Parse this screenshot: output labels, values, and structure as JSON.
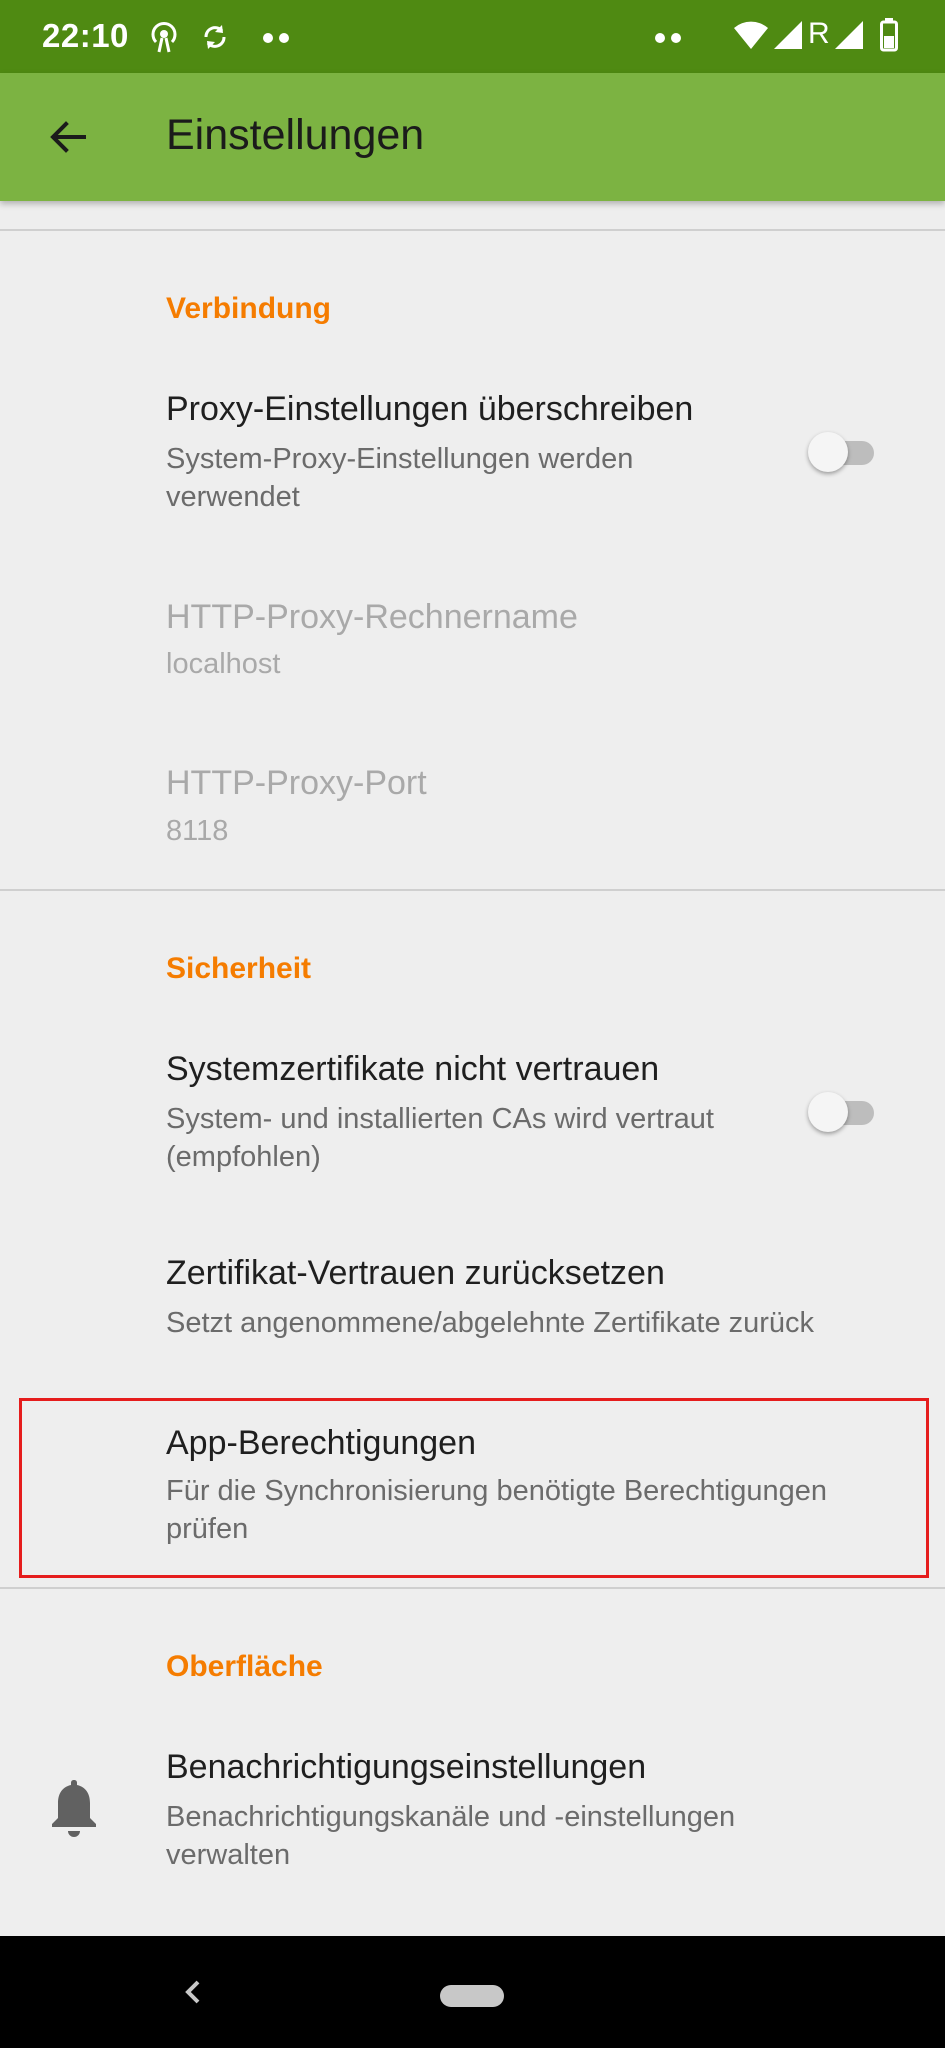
{
  "status_bar": {
    "time": "22:10",
    "icons_left": [
      "hotspot-icon",
      "sync-icon",
      "more-dots-icon"
    ],
    "icons_right": [
      "more-dots-icon",
      "wifi-icon",
      "cell-signal-icon",
      "roaming-indicator",
      "cell-signal-icon",
      "battery-icon"
    ],
    "roaming_label": "R"
  },
  "app_bar": {
    "title": "Einstellungen",
    "back_icon": "arrow-back-icon"
  },
  "categories": {
    "connection": "Verbindung",
    "security": "Sicherheit",
    "interface": "Oberfläche"
  },
  "items": {
    "proxy_override": {
      "title": "Proxy-Einstellungen überschreiben",
      "summary": "System-Proxy-Einstellungen werden verwendet",
      "switch_on": false
    },
    "proxy_host": {
      "title": "HTTP-Proxy-Rechnername",
      "summary": "localhost"
    },
    "proxy_port": {
      "title": "HTTP-Proxy-Port",
      "summary": "8118"
    },
    "distrust_system_certs": {
      "title": "Systemzertifikate nicht vertrauen",
      "summary": "System- und installierten CAs wird vertraut (empfohlen)",
      "switch_on": false
    },
    "reset_cert_trust": {
      "title": "Zertifikat-Vertrauen zurücksetzen",
      "summary": "Setzt angenommene/abgelehnte Zertifikate zurück"
    },
    "app_permissions": {
      "title": "App-Berechtigungen",
      "summary": "Für die Synchronisierung benötigte Berechtigungen prüfen"
    },
    "notification_settings": {
      "title": "Benachrichtigungseinstellungen",
      "summary": "Benachrichtigungskanäle und -einstellungen verwalten",
      "icon": "bell-icon"
    }
  },
  "colors": {
    "status_bar": "#4f8a12",
    "app_bar": "#7cb342",
    "category_accent": "#f57c00",
    "highlight_border": "#e51c1c"
  }
}
